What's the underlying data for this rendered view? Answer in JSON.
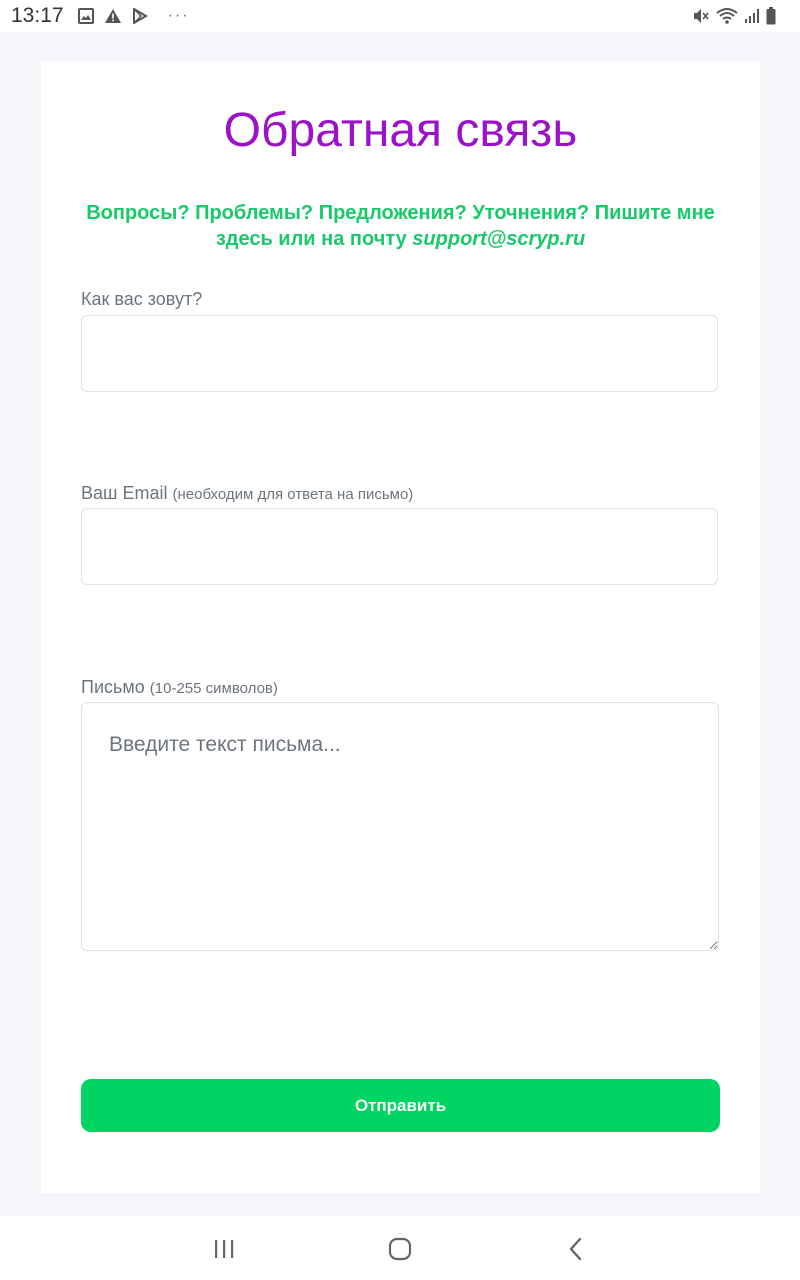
{
  "status_bar": {
    "time": "13:17",
    "left_icons": [
      "image-icon",
      "warning-icon",
      "play-store-icon"
    ],
    "more": "···",
    "right_icons": [
      "mute-icon",
      "wifi-icon",
      "signal-icon",
      "battery-icon"
    ]
  },
  "form": {
    "title": "Обратная связь",
    "subtitle_text": "Вопросы? Проблемы? Предложения? Уточнения? Пишите мне здесь или на почту ",
    "subtitle_email": "support@scryp.ru",
    "name_label": "Как вас зовут?",
    "name_value": "",
    "email_label": "Ваш Email",
    "email_hint": "(необходим для ответа на письмо)",
    "email_value": "",
    "message_label": "Письмо",
    "message_hint": "(10-255 символов)",
    "message_placeholder": "Введите текст письма...",
    "submit_label": "Отправить"
  },
  "nav_bar": {
    "buttons": [
      "recent-apps-icon",
      "home-icon",
      "back-icon"
    ]
  },
  "colors": {
    "title": "#9b12c8",
    "subtitle": "#19c96a",
    "submit": "#00d463",
    "page_background": "#f5f6fa"
  }
}
